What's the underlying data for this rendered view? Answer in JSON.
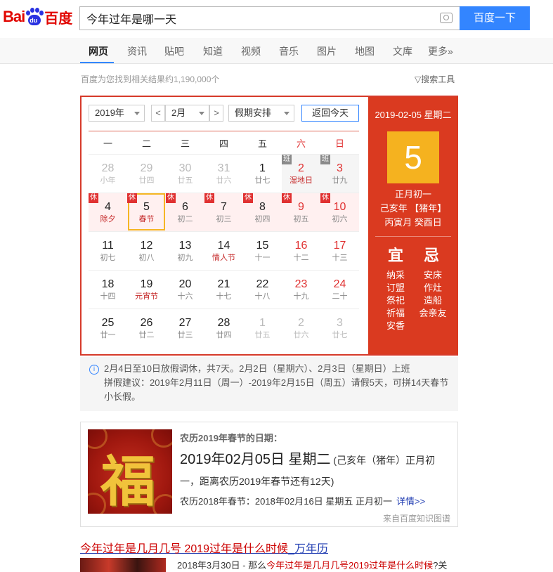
{
  "header": {
    "logo_bai": "Bai",
    "logo_du": "du",
    "logo_cn": "百度",
    "search_value": "今年过年是哪一天",
    "search_button": "百度一下"
  },
  "nav": {
    "tabs": [
      "网页",
      "资讯",
      "贴吧",
      "知道",
      "视频",
      "音乐",
      "图片",
      "地图",
      "文库",
      "更多»"
    ],
    "active": "网页"
  },
  "result_count": "百度为您找到相关结果约1,190,000个",
  "search_tools": "搜索工具",
  "calendar": {
    "year_select": "2019年",
    "month_select": "2月",
    "prev": "<",
    "next": ">",
    "holiday_select": "假期安排",
    "today_button": "返回今天",
    "weekdays": [
      "一",
      "二",
      "三",
      "四",
      "五",
      "六",
      "日"
    ],
    "rest_tag": "休",
    "work_tag": "班",
    "weeks": [
      [
        {
          "d": "28",
          "l": "小年",
          "grey": true
        },
        {
          "d": "29",
          "l": "廿四",
          "grey": true
        },
        {
          "d": "30",
          "l": "廿五",
          "grey": true
        },
        {
          "d": "31",
          "l": "廿六",
          "grey": true
        },
        {
          "d": "1",
          "l": "廿七"
        },
        {
          "d": "2",
          "l": "湿地日",
          "red": true,
          "festival": true,
          "work": true
        },
        {
          "d": "3",
          "l": "廿九",
          "red": true,
          "work": true
        }
      ],
      [
        {
          "d": "4",
          "l": "除夕",
          "festival": true,
          "holiday": true
        },
        {
          "d": "5",
          "l": "春节",
          "festival": true,
          "holiday": true,
          "selected": true
        },
        {
          "d": "6",
          "l": "初二",
          "holiday": true
        },
        {
          "d": "7",
          "l": "初三",
          "holiday": true
        },
        {
          "d": "8",
          "l": "初四",
          "holiday": true
        },
        {
          "d": "9",
          "l": "初五",
          "red": true,
          "holiday": true
        },
        {
          "d": "10",
          "l": "初六",
          "red": true,
          "holiday": true
        }
      ],
      [
        {
          "d": "11",
          "l": "初七"
        },
        {
          "d": "12",
          "l": "初八"
        },
        {
          "d": "13",
          "l": "初九"
        },
        {
          "d": "14",
          "l": "情人节",
          "festival": true
        },
        {
          "d": "15",
          "l": "十一"
        },
        {
          "d": "16",
          "l": "十二",
          "red": true
        },
        {
          "d": "17",
          "l": "十三",
          "red": true
        }
      ],
      [
        {
          "d": "18",
          "l": "十四"
        },
        {
          "d": "19",
          "l": "元宵节",
          "festival": true
        },
        {
          "d": "20",
          "l": "十六"
        },
        {
          "d": "21",
          "l": "十七"
        },
        {
          "d": "22",
          "l": "十八"
        },
        {
          "d": "23",
          "l": "十九",
          "red": true
        },
        {
          "d": "24",
          "l": "二十",
          "red": true
        }
      ],
      [
        {
          "d": "25",
          "l": "廿一"
        },
        {
          "d": "26",
          "l": "廿二"
        },
        {
          "d": "27",
          "l": "廿三"
        },
        {
          "d": "28",
          "l": "廿四"
        },
        {
          "d": "1",
          "l": "廿五",
          "grey": true
        },
        {
          "d": "2",
          "l": "廿六",
          "grey": true
        },
        {
          "d": "3",
          "l": "廿七",
          "grey": true
        }
      ]
    ],
    "side": {
      "date": "2019-02-05 星期二",
      "day": "5",
      "lunar_day": "正月初一",
      "lunar_year": "己亥年 【猪年】",
      "ganzhi": "丙寅月 癸酉日",
      "yi": "宜",
      "ji": "忌",
      "yi_items": [
        "纳采",
        "订盟",
        "祭祀",
        "祈福",
        "安香"
      ],
      "ji_items": [
        "安床",
        "作灶",
        "造船",
        "会亲友"
      ]
    }
  },
  "notice": {
    "line1": "2月4日至10日放假调休，共7天。2月2日（星期六）、2月3日（星期日）上班",
    "line2": "拼假建议：2019年2月11日（周一）-2019年2月15日（周五）请假5天，可拼14天春节小长假。"
  },
  "card": {
    "image_char": "福",
    "kicker": "农历2019年春节的日期：",
    "date_big": "2019年02月05日 星期二",
    "date_rest": " (己亥年（猪年）正月初一，距离农历2019年春节还有12天)",
    "sub": "农历2018年春节：2018年02月16日 星期五 正月初一",
    "details": "详情>>",
    "source": "来自百度知识图谱"
  },
  "result": {
    "title_p1": "今年过年是几月几号 2019过年是什么时候",
    "title_p2": "_万年历",
    "snippet_prefix": "2018年3月30日 - 那么",
    "snippet_em": "今年过年是几月几号2019过年是什么时候",
    "snippet_suffix": "?关"
  }
}
